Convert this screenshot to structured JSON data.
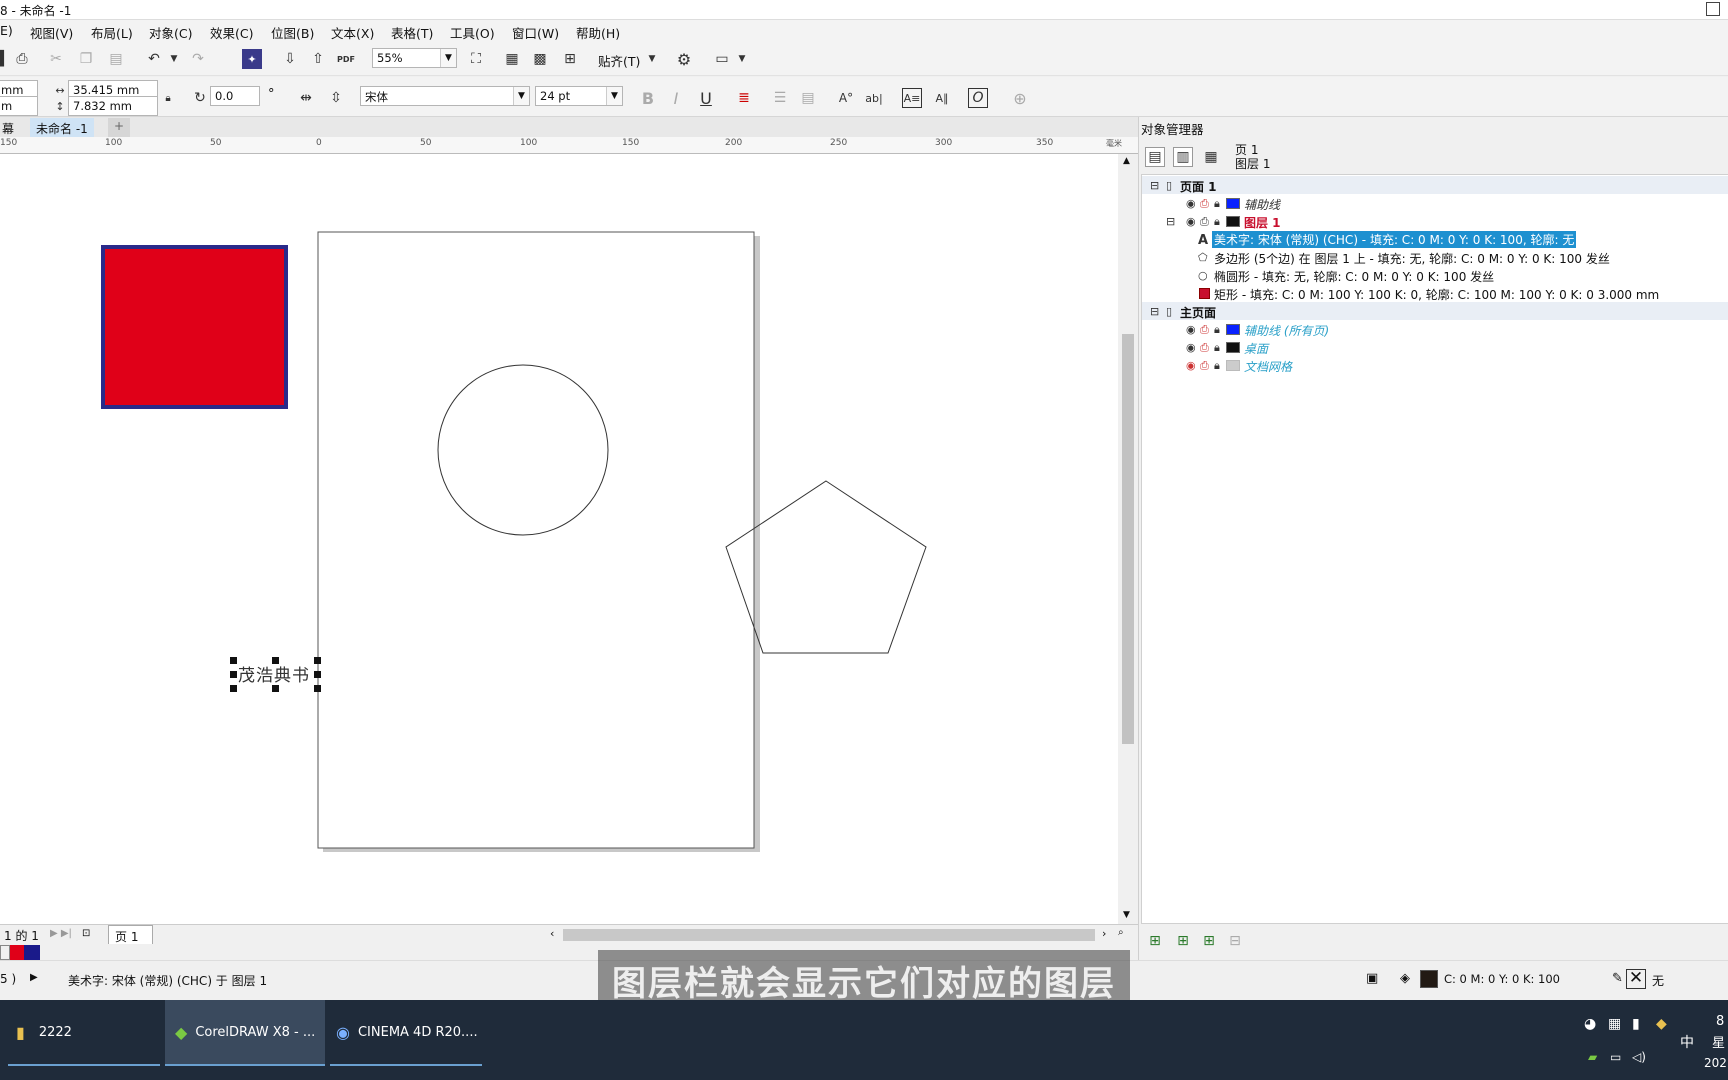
{
  "titlebar": {
    "title": "8 - 未命名 -1"
  },
  "menubar": {
    "items": [
      "E)",
      "视图(V)",
      "布局(L)",
      "对象(C)",
      "效果(C)",
      "位图(B)",
      "文本(X)",
      "表格(T)",
      "工具(O)",
      "窗口(W)",
      "帮助(H)"
    ]
  },
  "toolbar": {
    "zoom": "55%",
    "snap_label": "贴齐(T)",
    "pdf_label": "PDF"
  },
  "propbar": {
    "unit1": "mm",
    "unit2": "m",
    "width": "35.415 mm",
    "height": "7.832 mm",
    "rotation": "0.0",
    "degree": "°",
    "font": "宋体",
    "font_size": "24 pt",
    "bold": "B",
    "italic": "I",
    "underline": "U"
  },
  "doctabs": {
    "left_label": "幕",
    "active": "未命名 -1",
    "add": "+"
  },
  "ruler": {
    "ticks": [
      "150",
      "100",
      "50",
      "0",
      "50",
      "100",
      "150",
      "200",
      "250",
      "300",
      "350"
    ],
    "unit": "毫米"
  },
  "canvas": {
    "text_object": "茂浩典书",
    "rect_fill": "#e00018",
    "rect_outline": "#2a2a8a"
  },
  "pagebar": {
    "page_of": "1 的 1",
    "page_tab": "页 1"
  },
  "palette": {
    "colors": [
      "#ffffff",
      "#e00018",
      "#1a1a8a"
    ]
  },
  "statusbar": {
    "left": "5 )",
    "info": "美术字: 宋体 (常规) (CHC) 于 图层 1",
    "fill_info": "C: 0 M: 0 Y: 0 K: 100",
    "outline": "无"
  },
  "panel": {
    "title": "对象管理器",
    "header_page": "页 1",
    "header_layer": "图层 1",
    "tree": {
      "page1": "页面 1",
      "guides": "辅助线",
      "layer1": "图层 1",
      "obj_text": "美术字: 宋体 (常规) (CHC) - 填充: C: 0 M: 0 Y: 0 K: 100, 轮廓: 无",
      "obj_polygon": "多边形 (5个边) 在 图层 1 上 - 填充: 无, 轮廓: C: 0 M: 0 Y: 0 K: 100 发丝",
      "obj_ellipse": "椭圆形 - 填充: 无, 轮廓: C: 0 M: 0 Y: 0 K: 100 发丝",
      "obj_rect": "矩形 - 填充: C: 0 M: 100 Y: 100 K: 0, 轮廓: C: 100 M: 100 Y: 0 K: 0  3.000 mm",
      "master": "主页面",
      "guides_all": "辅助线 (所有页)",
      "desktop": "桌面",
      "grid": "文档网格"
    }
  },
  "subtitle": "图层栏就会显示它们对应的图层",
  "taskbar": {
    "items": [
      "2222",
      "CorelDRAW X8 - ...",
      "CINEMA 4D R20...."
    ],
    "tray_lang": "中",
    "tray_day": "星",
    "tray_year": "202",
    "tray_num": "8"
  }
}
